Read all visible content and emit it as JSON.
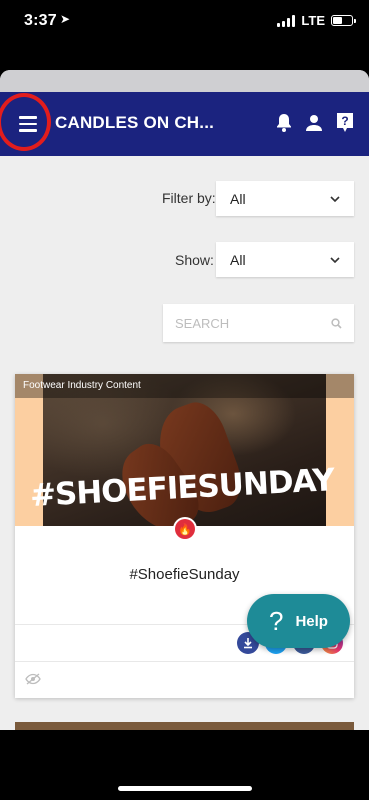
{
  "status_bar": {
    "time": "3:37",
    "network": "LTE"
  },
  "header": {
    "title": "CANDLES ON CH...",
    "icons": [
      "menu-icon",
      "bell-icon",
      "user-icon",
      "help-question-icon"
    ]
  },
  "filters": {
    "filter_by_label": "Filter by:",
    "filter_by_value": "All",
    "show_label": "Show:",
    "show_value": "All"
  },
  "search": {
    "placeholder": "SEARCH"
  },
  "card": {
    "category": "Footwear Industry Content",
    "image_hashtag": "#SHOEFIESUNDAY",
    "title": "#ShoefieSunday",
    "share_icons": [
      "download-icon",
      "twitter-icon",
      "facebook-icon",
      "instagram-icon"
    ]
  },
  "help_button": {
    "label": "Help"
  },
  "colors": {
    "header_bg": "#1b237f",
    "highlight_ring": "#e21d1d",
    "help_bg": "#1e8b97",
    "card_media_bg": "#fccfa1"
  }
}
